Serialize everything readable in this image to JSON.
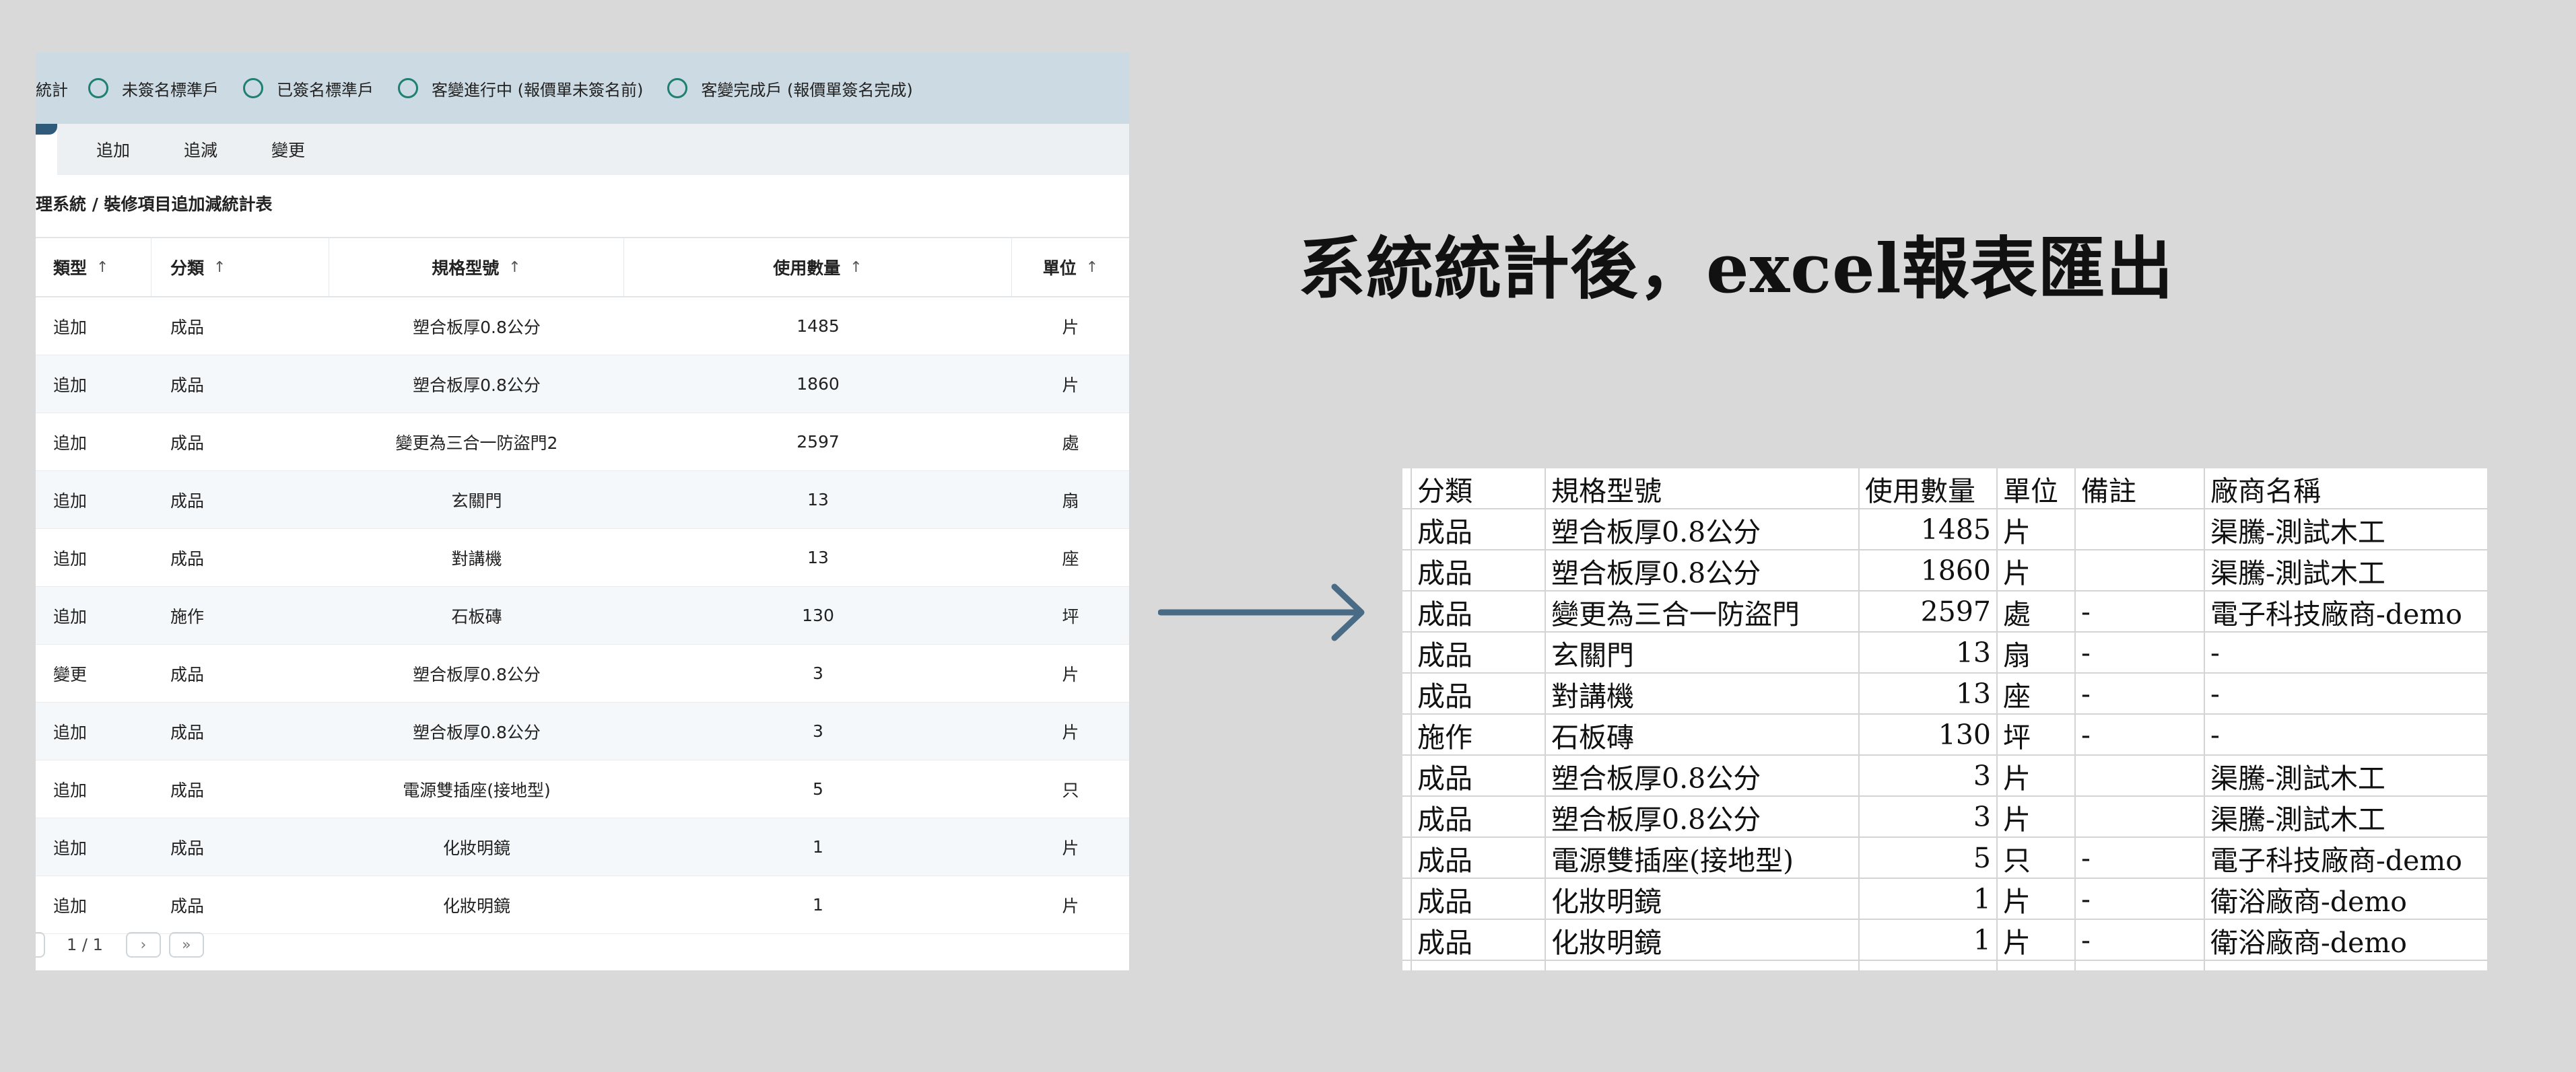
{
  "filters": {
    "lead": "統計",
    "options": [
      {
        "label": "未簽名標準戶"
      },
      {
        "label": "已簽名標準戶"
      },
      {
        "label": "客變進行中 (報價單未簽名前)"
      },
      {
        "label": "客變完成戶 (報價單簽名完成)"
      }
    ]
  },
  "tabs": [
    "追加",
    "追減",
    "變更"
  ],
  "breadcrumb": "理系統 / 裝修項目追加減統計表",
  "table": {
    "headers": {
      "type": "類型",
      "category": "分類",
      "spec": "規格型號",
      "qty": "使用數量",
      "unit": "單位",
      "sort_icon": "↑"
    },
    "rows": [
      {
        "type": "追加",
        "category": "成品",
        "spec": "塑合板厚0.8公分",
        "qty": "1485",
        "unit": "片"
      },
      {
        "type": "追加",
        "category": "成品",
        "spec": "塑合板厚0.8公分",
        "qty": "1860",
        "unit": "片"
      },
      {
        "type": "追加",
        "category": "成品",
        "spec": "變更為三合一防盜門2",
        "qty": "2597",
        "unit": "處"
      },
      {
        "type": "追加",
        "category": "成品",
        "spec": "玄關門",
        "qty": "13",
        "unit": "扇"
      },
      {
        "type": "追加",
        "category": "成品",
        "spec": "對講機",
        "qty": "13",
        "unit": "座"
      },
      {
        "type": "追加",
        "category": "施作",
        "spec": "石板磚",
        "qty": "130",
        "unit": "坪"
      },
      {
        "type": "變更",
        "category": "成品",
        "spec": "塑合板厚0.8公分",
        "qty": "3",
        "unit": "片"
      },
      {
        "type": "追加",
        "category": "成品",
        "spec": "塑合板厚0.8公分",
        "qty": "3",
        "unit": "片"
      },
      {
        "type": "追加",
        "category": "成品",
        "spec": "電源雙插座(接地型)",
        "qty": "5",
        "unit": "只"
      },
      {
        "type": "追加",
        "category": "成品",
        "spec": "化妝明鏡",
        "qty": "1",
        "unit": "片"
      },
      {
        "type": "追加",
        "category": "成品",
        "spec": "化妝明鏡",
        "qty": "1",
        "unit": "片"
      }
    ]
  },
  "pager": {
    "text": "1 / 1",
    "next": "›",
    "last": "»"
  },
  "headline": "系統統計後，excel報表匯出",
  "excel": {
    "headers": [
      "分類",
      "規格型號",
      "使用數量",
      "單位",
      "備註",
      "廠商名稱"
    ],
    "rows": [
      [
        "成品",
        "塑合板厚0.8公分",
        "1485",
        "片",
        "",
        "渠騰-測試木工"
      ],
      [
        "成品",
        "塑合板厚0.8公分",
        "1860",
        "片",
        "",
        "渠騰-測試木工"
      ],
      [
        "成品",
        "變更為三合一防盜門",
        "2597",
        "處",
        "-",
        "電子科技廠商-demo"
      ],
      [
        "成品",
        "玄關門",
        "13",
        "扇",
        "-",
        "-"
      ],
      [
        "成品",
        "對講機",
        "13",
        "座",
        "-",
        "-"
      ],
      [
        "施作",
        "石板磚",
        "130",
        "坪",
        "-",
        "-"
      ],
      [
        "成品",
        "塑合板厚0.8公分",
        "3",
        "片",
        "",
        "渠騰-測試木工"
      ],
      [
        "成品",
        "塑合板厚0.8公分",
        "3",
        "片",
        "",
        "渠騰-測試木工"
      ],
      [
        "成品",
        "電源雙插座(接地型)",
        "5",
        "只",
        "-",
        "電子科技廠商-demo"
      ],
      [
        "成品",
        "化妝明鏡",
        "1",
        "片",
        "-",
        "衛浴廠商-demo"
      ],
      [
        "成品",
        "化妝明鏡",
        "1",
        "片",
        "-",
        "衛浴廠商-demo"
      ]
    ]
  },
  "colors": {
    "accent_teal": "#1f7f72",
    "arrow": "#4a6b85",
    "filter_bg": "#ccdae3"
  }
}
